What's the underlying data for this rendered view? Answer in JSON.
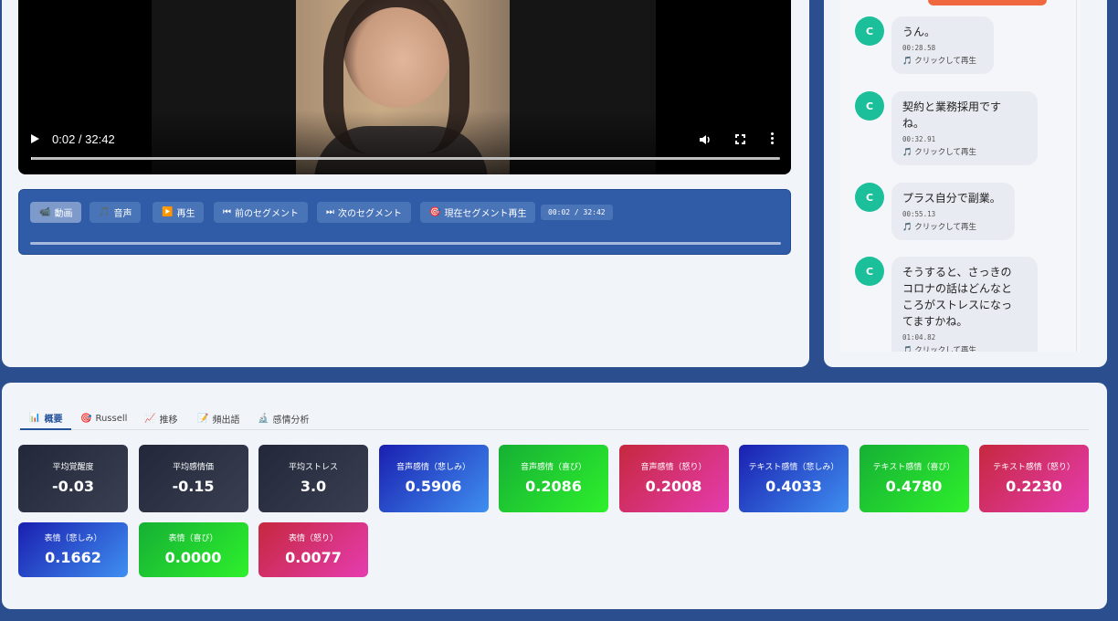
{
  "video": {
    "time_label": "0:02 / 32:42",
    "progress": 0.001
  },
  "player_controls": {
    "buttons": [
      {
        "icon": "📹",
        "label": "動画"
      },
      {
        "icon": "🎵",
        "label": "音声"
      },
      {
        "icon": "▶️",
        "label": "再生"
      },
      {
        "icon": "⏮",
        "label": "前のセグメント"
      },
      {
        "icon": "⏭",
        "label": "次のセグメント"
      },
      {
        "icon": "🎯",
        "label": "現在セグメント再生"
      }
    ],
    "time_display": "00:02 / 32:42"
  },
  "chat": {
    "replay_label": "🎵 クリックして再生",
    "messages": [
      {
        "avatar": "C",
        "text": "うん。",
        "timestamp": "00:28.58"
      },
      {
        "avatar": "C",
        "text": "契約と業務採用です\nね。",
        "timestamp": "00:32.91"
      },
      {
        "avatar": "C",
        "text": "プラス自分で副業。",
        "timestamp": "00:55.13"
      },
      {
        "avatar": "C",
        "text": "そうすると、さっきの\nコロナの話はどんなと\nころがストレスになっ\nてますかね。",
        "timestamp": "01:04.82"
      }
    ]
  },
  "stats": {
    "tabs": [
      {
        "icon": "📊",
        "label": "概要"
      },
      {
        "icon": "🎯",
        "label": "Russell"
      },
      {
        "icon": "📈",
        "label": "推移"
      },
      {
        "icon": "📝",
        "label": "頻出語"
      },
      {
        "icon": "🔬",
        "label": "感情分析"
      }
    ],
    "cards": [
      {
        "label": "平均覚醒度",
        "value": "-0.03",
        "color": "dark"
      },
      {
        "label": "平均感情価",
        "value": "-0.15",
        "color": "dark"
      },
      {
        "label": "平均ストレス",
        "value": "3.0",
        "color": "dark"
      },
      {
        "label": "音声感情（悲しみ）",
        "value": "0.5906",
        "color": "blue"
      },
      {
        "label": "音声感情（喜び）",
        "value": "0.2086",
        "color": "green"
      },
      {
        "label": "音声感情（怒り）",
        "value": "0.2008",
        "color": "red"
      },
      {
        "label": "テキスト感情（悲しみ）",
        "value": "0.4033",
        "color": "blue"
      },
      {
        "label": "テキスト感情（喜び）",
        "value": "0.4780",
        "color": "green"
      },
      {
        "label": "テキスト感情（怒り）",
        "value": "0.2230",
        "color": "red"
      },
      {
        "label": "表情（悲しみ）",
        "value": "0.1662",
        "color": "blue"
      },
      {
        "label": "表情（喜び）",
        "value": "0.0000",
        "color": "green"
      },
      {
        "label": "表情（怒り）",
        "value": "0.0077",
        "color": "red"
      }
    ]
  }
}
